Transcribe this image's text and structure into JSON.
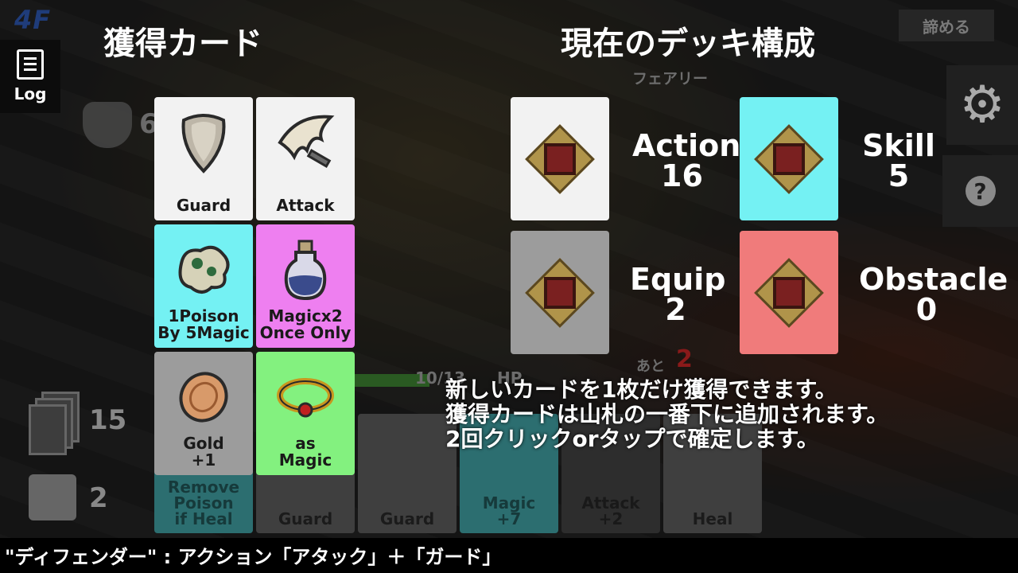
{
  "hud": {
    "floor": "4F",
    "log_label": "Log",
    "giveup_label": "諦める",
    "shield_value": "6",
    "deck_count": "15",
    "discard_count": "2",
    "enemy_name": "フェアリー",
    "remaining_label": "あと",
    "remaining_value": "2",
    "hp_text": "10/13",
    "hp_label": "HP"
  },
  "titles": {
    "acquire": "獲得カード",
    "deck": "現在のデッキ構成"
  },
  "reward_cards": [
    {
      "label": "Guard",
      "color": "#f2f2f2",
      "icon": "shield-icon"
    },
    {
      "label": "Attack",
      "color": "#f2f2f2",
      "icon": "claw-icon"
    },
    {
      "label": "1Poison\nBy 5Magic",
      "color": "#74f1f3",
      "icon": "poison-cloud-icon"
    },
    {
      "label": "Magicx2\nOnce Only",
      "color": "#ee7ff0",
      "icon": "potion-icon"
    },
    {
      "label": "Gold\n+1",
      "color": "#9c9c9c",
      "icon": "coin-icon"
    },
    {
      "label": "as\nMagic",
      "color": "#83f17f",
      "icon": "ring-icon"
    }
  ],
  "deck_composition": [
    {
      "name": "Action",
      "count": "16",
      "color": "#f2f2f2"
    },
    {
      "name": "Skill",
      "count": "5",
      "color": "#74f1f3"
    },
    {
      "name": "Equip",
      "count": "2",
      "color": "#9c9c9c"
    },
    {
      "name": "Obstacle",
      "count": "0",
      "color": "#f07b7b"
    }
  ],
  "hand": [
    {
      "label": "Remove\nPoison\nif Heal"
    },
    {
      "label": "Guard"
    },
    {
      "label": "Guard"
    },
    {
      "label": "Magic\n+7"
    },
    {
      "label": "Attack\n+2"
    },
    {
      "label": "Heal"
    }
  ],
  "instructions": [
    "新しいカードを1枚だけ獲得できます。",
    "獲得カードは山札の一番下に追加されます。",
    "2回クリックorタップで確定します。"
  ],
  "description": "\"ディフェンダー\" : アクション「アタック」＋「ガード」"
}
